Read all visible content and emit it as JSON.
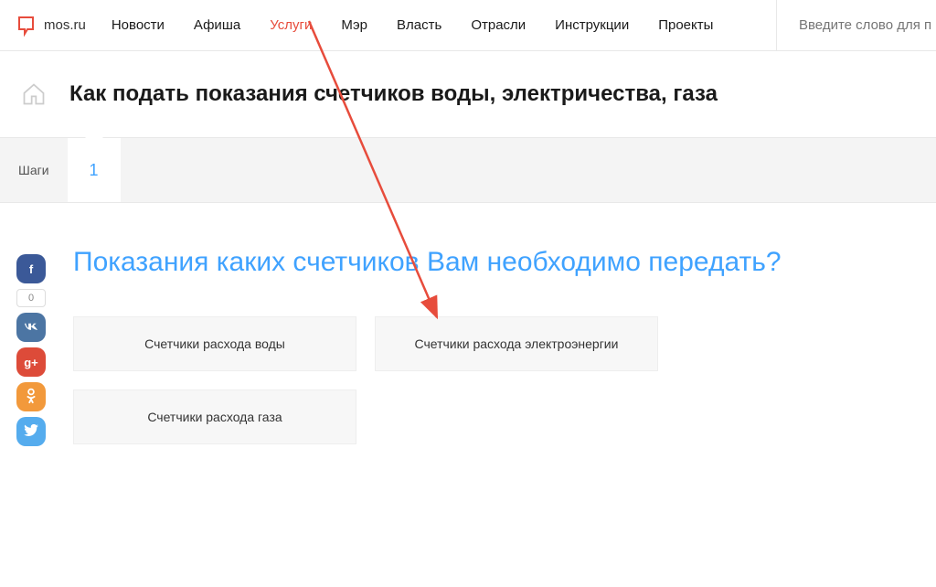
{
  "logo": {
    "text": "mos.ru"
  },
  "nav": {
    "items": [
      {
        "label": "Новости"
      },
      {
        "label": "Афиша"
      },
      {
        "label": "Услуги",
        "active": true
      },
      {
        "label": "Мэр"
      },
      {
        "label": "Власть"
      },
      {
        "label": "Отрасли"
      },
      {
        "label": "Инструкции"
      },
      {
        "label": "Проекты"
      }
    ]
  },
  "search": {
    "placeholder": "Введите слово для п"
  },
  "page": {
    "title": "Как подать показания счетчиков воды, электричества, газа"
  },
  "steps": {
    "label": "Шаги",
    "current": "1"
  },
  "content": {
    "question": "Показания каких счетчиков Вам необходимо передать?",
    "options": [
      {
        "label": "Счетчики расхода воды"
      },
      {
        "label": "Счетчики расхода электроэнергии"
      },
      {
        "label": "Счетчики расхода газа"
      }
    ]
  },
  "social": {
    "counter": "0",
    "buttons": [
      {
        "name": "facebook",
        "label": "f",
        "class": "fb"
      },
      {
        "name": "vk",
        "label": "w",
        "class": "vk"
      },
      {
        "name": "google-plus",
        "label": "g+",
        "class": "gp"
      },
      {
        "name": "odnoklassniki",
        "label": "໐",
        "class": "ok"
      },
      {
        "name": "twitter",
        "label": "",
        "class": "tw"
      }
    ]
  }
}
